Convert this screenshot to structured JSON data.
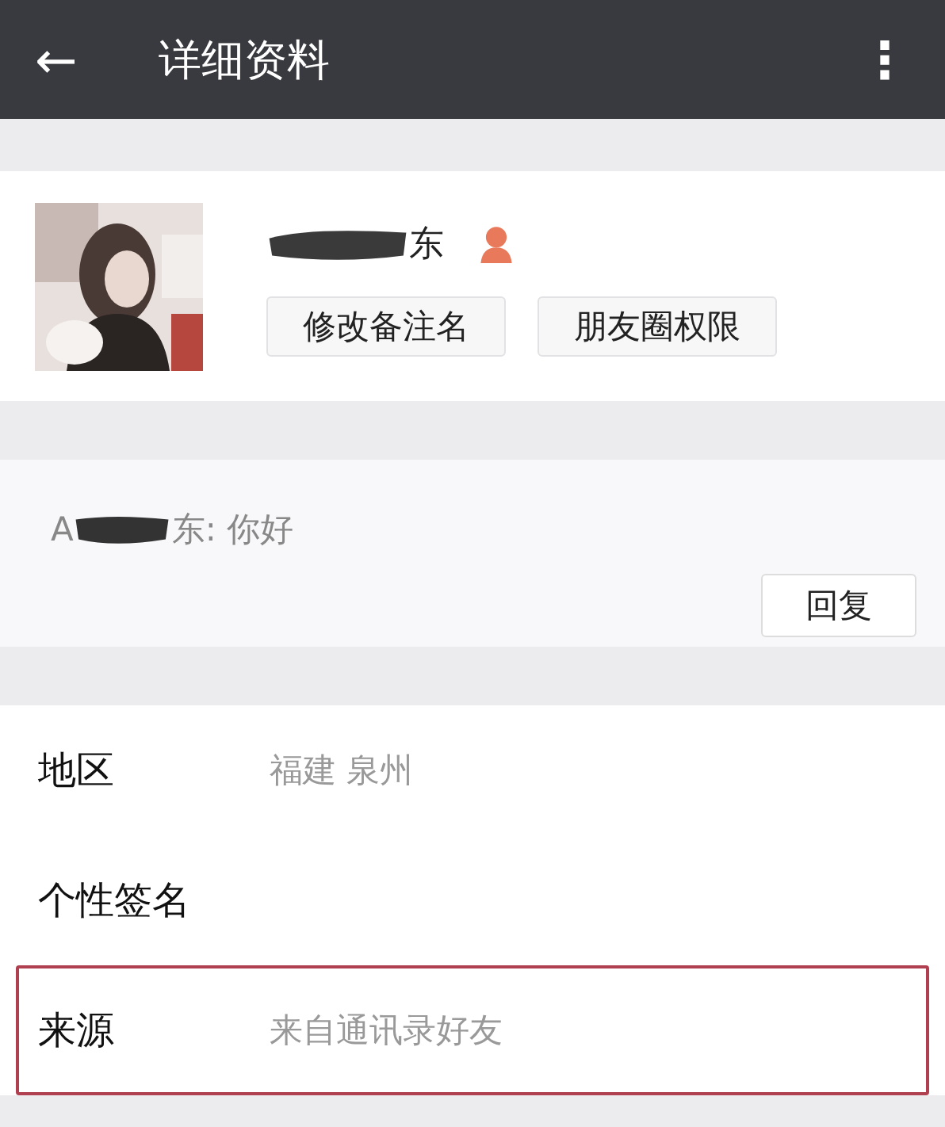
{
  "header": {
    "back": "←",
    "title": "详细资料",
    "menu": "⋮"
  },
  "profile": {
    "kind": "picture",
    "name_visible": "东",
    "buttons": [
      "修改备注名",
      "朋友圈权限"
    ]
  },
  "message": {
    "sender_prefix": "A",
    "text": "东: 你好",
    "reply_button": "回复"
  },
  "info_rows": [
    {
      "label": "地区",
      "value": "福建  泉州",
      "highlighted": false
    },
    {
      "label": "个性签名",
      "highlighted": false
    },
    {
      "label": "来源",
      "value": "来自通讯录好友",
      "highlighted": true
    }
  ]
}
